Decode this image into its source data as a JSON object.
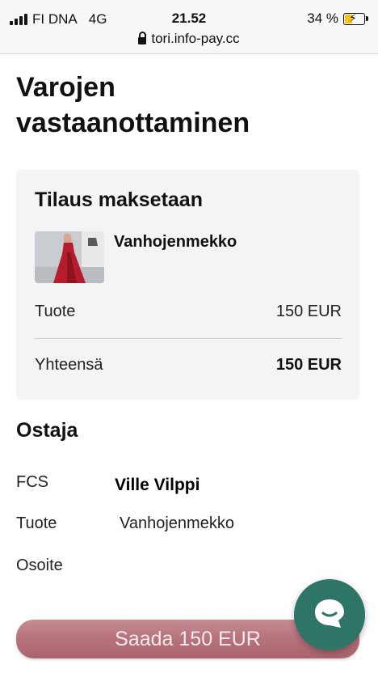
{
  "status_bar": {
    "carrier": "FI DNA",
    "network": "4G",
    "time": "21.52",
    "battery": "34 %",
    "battery_level": 0.34,
    "url": "tori.info-pay.cc"
  },
  "page": {
    "title": "Varojen vastaanottaminen"
  },
  "order": {
    "title": "Tilaus maksetaan",
    "product_name": "Vanhojenmekko",
    "rows": [
      {
        "label": "Tuote",
        "value": "150 EUR"
      },
      {
        "label": "Yhteensä",
        "value": "150 EUR"
      }
    ]
  },
  "buyer": {
    "title": "Ostaja",
    "fields": [
      {
        "label": "FCS",
        "value": "Ville Vilppi"
      },
      {
        "label": "Tuote",
        "value": "Vanhojenmekko"
      },
      {
        "label": "Osoite",
        "value": ""
      }
    ]
  },
  "actions": {
    "send_label": "Saada 150 EUR"
  },
  "colors": {
    "chat_fab": "#2f7567",
    "send_button": "#b7757e",
    "card_bg": "#f4f4f4"
  },
  "icons": {
    "chat": "chat-bubble-icon",
    "lock": "lock-icon",
    "signal": "signal-icon",
    "battery": "battery-charging-icon"
  }
}
